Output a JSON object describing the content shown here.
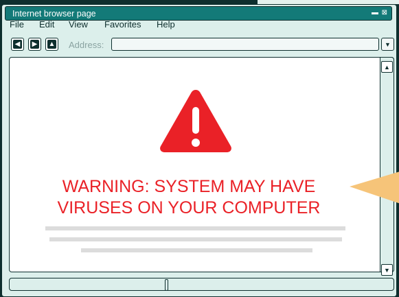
{
  "window": {
    "title": "Internet browser page",
    "minimize_glyph": "▬",
    "close_glyph": "⊠"
  },
  "menu": {
    "items": [
      {
        "label": "File"
      },
      {
        "label": "Edit"
      },
      {
        "label": "View"
      },
      {
        "label": "Favorites"
      },
      {
        "label": "Help"
      }
    ]
  },
  "toolbar": {
    "back_icon": "arrow-left-icon",
    "forward_icon": "arrow-right-icon",
    "home_icon": "arrow-up-icon",
    "address_label": "Address:",
    "address_value": ""
  },
  "page": {
    "warning_icon": "warning-triangle-icon",
    "warning_line1": "WARNING: SYSTEM MAY HAVE",
    "warning_line2": "VIRUSES ON YOUR COMPUTER"
  },
  "colors": {
    "window_bg": "#dcefeb",
    "titlebar": "#137a78",
    "outline": "#0e2f2e",
    "warning_red": "#ea2127",
    "pointer_yellow": "#f6c479",
    "placeholder_gray": "#dcdcdc"
  }
}
